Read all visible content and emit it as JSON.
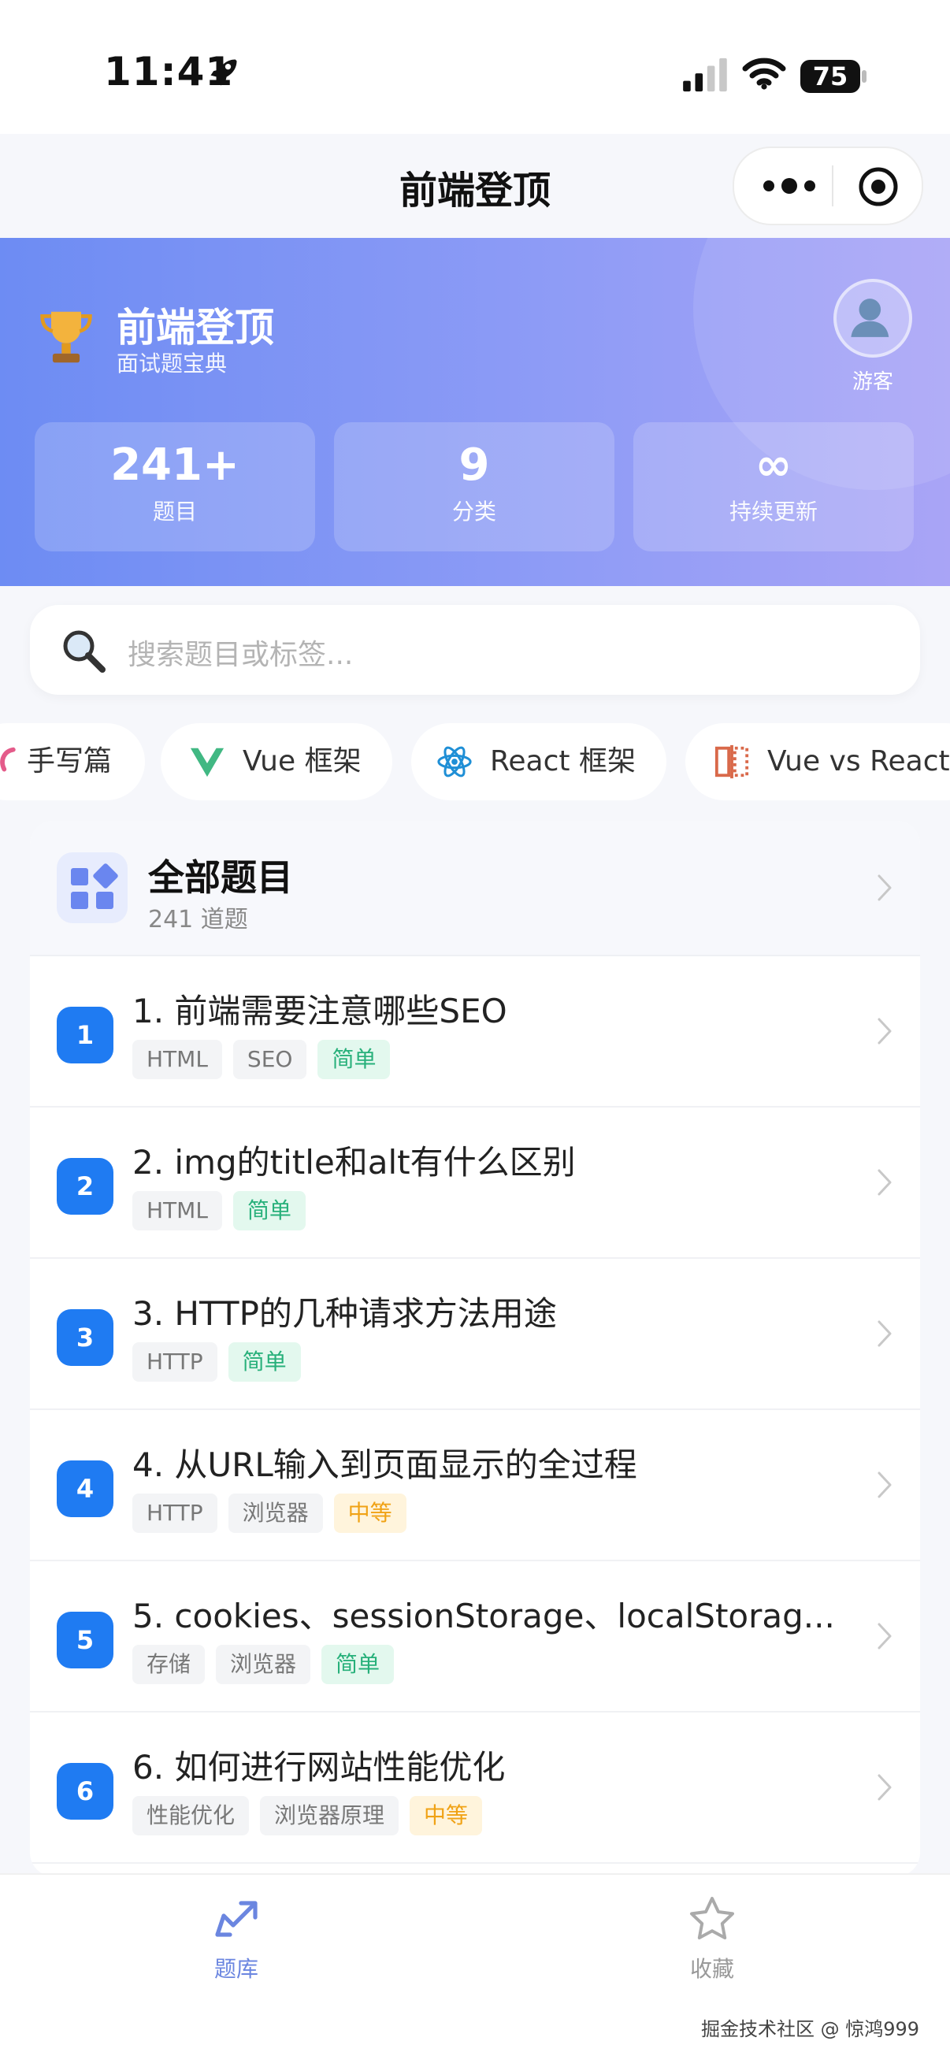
{
  "status": {
    "time": "11:41",
    "battery": "75"
  },
  "titlebar": {
    "title": "前端登顶"
  },
  "hero": {
    "brand": "前端登顶",
    "subtitle": "面试题宝典",
    "avatar_label": "游客",
    "stats": [
      {
        "value": "241+",
        "label": "题目"
      },
      {
        "value": "9",
        "label": "分类"
      },
      {
        "value": "∞",
        "label": "持续更新"
      }
    ]
  },
  "search": {
    "placeholder": "搜索题目或标签..."
  },
  "chips": [
    {
      "label": "手写篇",
      "icon": "hand-icon"
    },
    {
      "label": "Vue 框架",
      "icon": "vue-icon"
    },
    {
      "label": "React 框架",
      "icon": "react-icon"
    },
    {
      "label": "Vue vs React",
      "icon": "compare-icon"
    }
  ],
  "list": {
    "header": {
      "title": "全部题目",
      "subtitle": "241 道题"
    },
    "items": [
      {
        "num": "1",
        "title": "1. 前端需要注意哪些SEO",
        "tags": [
          {
            "text": "HTML",
            "type": "plain"
          },
          {
            "text": "SEO",
            "type": "plain"
          },
          {
            "text": "简单",
            "type": "easy"
          }
        ]
      },
      {
        "num": "2",
        "title": "2. img的title和alt有什么区别",
        "tags": [
          {
            "text": "HTML",
            "type": "plain"
          },
          {
            "text": "简单",
            "type": "easy"
          }
        ]
      },
      {
        "num": "3",
        "title": "3. HTTP的几种请求方法用途",
        "tags": [
          {
            "text": "HTTP",
            "type": "plain"
          },
          {
            "text": "简单",
            "type": "easy"
          }
        ]
      },
      {
        "num": "4",
        "title": "4. 从URL输入到页面显示的全过程",
        "tags": [
          {
            "text": "HTTP",
            "type": "plain"
          },
          {
            "text": "浏览器",
            "type": "plain"
          },
          {
            "text": "中等",
            "type": "mid"
          }
        ]
      },
      {
        "num": "5",
        "title": "5. cookies、sessionStorage、localStorag...",
        "tags": [
          {
            "text": "存储",
            "type": "plain"
          },
          {
            "text": "浏览器",
            "type": "plain"
          },
          {
            "text": "简单",
            "type": "easy"
          }
        ]
      },
      {
        "num": "6",
        "title": "6. 如何进行网站性能优化",
        "tags": [
          {
            "text": "性能优化",
            "type": "plain"
          },
          {
            "text": "浏览器原理",
            "type": "plain"
          },
          {
            "text": "中等",
            "type": "mid"
          }
        ]
      }
    ]
  },
  "tabbar": {
    "tabs": [
      {
        "label": "题库",
        "active": true
      },
      {
        "label": "收藏",
        "active": false
      }
    ]
  },
  "watermark": "掘金技术社区 @ 惊鸿999",
  "colors": {
    "accent": "#1f7bf2",
    "hero_start": "#6d8cf3",
    "hero_end": "#a9a4f6",
    "tab_active": "#6b86e0",
    "tab_inactive": "#aaaaaa"
  }
}
